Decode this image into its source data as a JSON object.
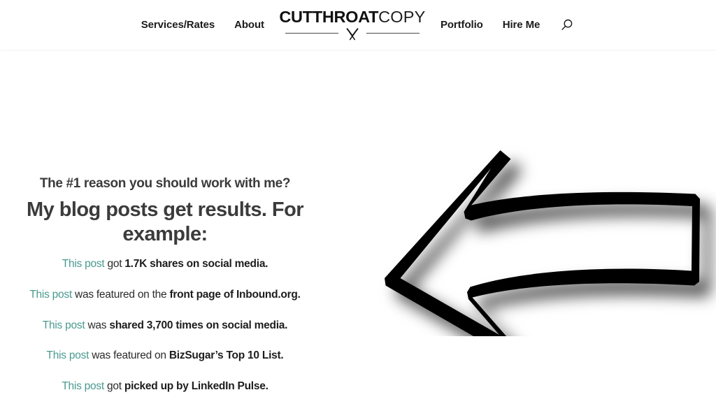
{
  "header": {
    "nav_left": [
      {
        "label": "Services/Rates",
        "name": "nav-link-services-rates"
      },
      {
        "label": "About",
        "name": "nav-link-about"
      }
    ],
    "nav_right": [
      {
        "label": "Portfolio",
        "name": "nav-link-portfolio"
      },
      {
        "label": "Hire Me",
        "name": "nav-link-hire-me"
      }
    ],
    "logo": {
      "bold_text": "CUTTHROAT",
      "light_text": "COPY",
      "mark_icon": "scissors-x-icon"
    },
    "search": {
      "icon": "search-icon",
      "aria_label": "Search"
    }
  },
  "main": {
    "eyebrow": "The #1 reason you should work with me?",
    "headline": "My blog posts get results. For example:",
    "proof_items": [
      {
        "link_text": "This post",
        "middle_text": " got ",
        "bold_text": "1.7K shares on social media."
      },
      {
        "link_text": "This post",
        "middle_text": " was featured on the ",
        "bold_text": "front page of Inbound.org."
      },
      {
        "link_text": "This post",
        "middle_text": " was ",
        "bold_text": "shared 3,700 times on social media."
      },
      {
        "link_text": "This post",
        "middle_text": " was featured on ",
        "bold_text": "BizSugar’s Top 10 List."
      },
      {
        "link_text": "This post",
        "middle_text": " got ",
        "bold_text": "picked up by LinkedIn Pulse."
      }
    ],
    "graphic": {
      "icon": "left-pointing-arrow-illustration",
      "description": "Large hand-drawn outlined arrow pointing left with drop shadow"
    }
  },
  "colors": {
    "background": "#ffffff",
    "heading_text": "#3b3b3b",
    "body_text": "#2b2b2b",
    "nav_text": "#1b1b1b",
    "link_teal": "#4a9a90",
    "arrow_black": "#000000"
  }
}
